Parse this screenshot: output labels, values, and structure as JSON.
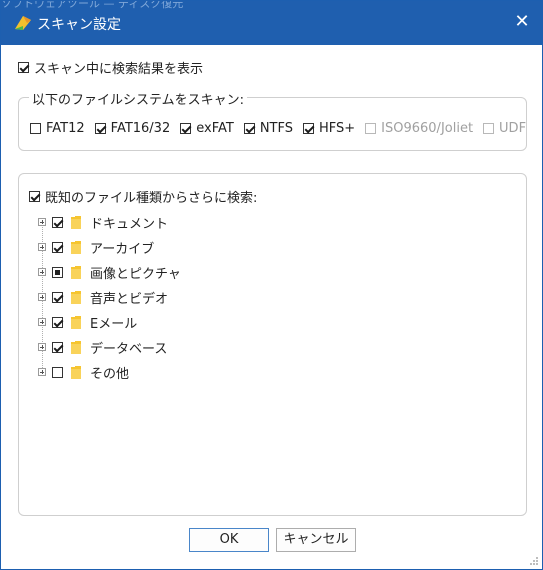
{
  "window": {
    "ghost_title": "ソフトウェアツール — ディスク復元",
    "title": "スキャン設定",
    "close_label": "✕"
  },
  "show_results_during_scan": {
    "label": "スキャン中に検索結果を表示",
    "checked": true
  },
  "filesystems": {
    "title": "以下のファイルシステムをスキャン:",
    "items": [
      {
        "label": "FAT12",
        "checked": false,
        "enabled": true
      },
      {
        "label": "FAT16/32",
        "checked": true,
        "enabled": true
      },
      {
        "label": "exFAT",
        "checked": true,
        "enabled": true
      },
      {
        "label": "NTFS",
        "checked": true,
        "enabled": true
      },
      {
        "label": "HFS+",
        "checked": true,
        "enabled": true
      },
      {
        "label": "ISO9660/Joliet",
        "checked": false,
        "enabled": false
      },
      {
        "label": "UDF",
        "checked": false,
        "enabled": false
      }
    ]
  },
  "known_types": {
    "title": "既知のファイル種類からさらに検索:",
    "checked": true,
    "items": [
      {
        "label": "ドキュメント",
        "state": "checked"
      },
      {
        "label": "アーカイブ",
        "state": "checked"
      },
      {
        "label": "画像とピクチャ",
        "state": "partial"
      },
      {
        "label": "音声とビデオ",
        "state": "checked"
      },
      {
        "label": "Eメール",
        "state": "checked"
      },
      {
        "label": "データベース",
        "state": "checked"
      },
      {
        "label": "その他",
        "state": "unchecked"
      }
    ]
  },
  "buttons": {
    "ok": "OK",
    "cancel": "キャンセル"
  },
  "colors": {
    "titlebar": "#1f5faf",
    "folder": "#f6c531"
  }
}
